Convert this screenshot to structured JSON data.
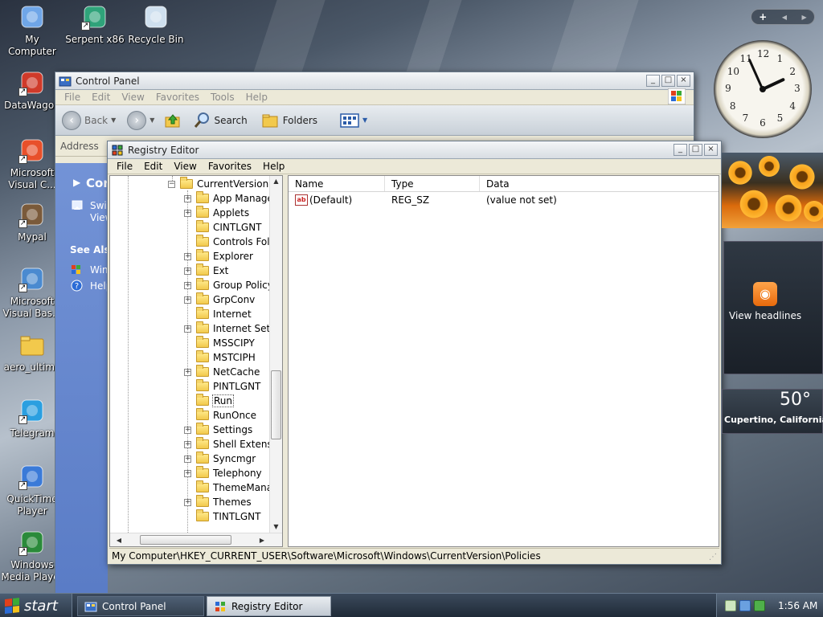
{
  "desktop": {
    "icons": [
      {
        "label": "My Computer",
        "icon": "computer-icon"
      },
      {
        "label": "Serpent x86",
        "icon": "serpent-icon"
      },
      {
        "label": "Recycle Bin",
        "icon": "recycle-bin-icon"
      },
      {
        "label": "DataWagon",
        "icon": "datawagon-icon"
      },
      {
        "label": "Microsoft Visual C...",
        "icon": "visual-c-icon"
      },
      {
        "label": "Mypal",
        "icon": "mypal-icon"
      },
      {
        "label": "Microsoft Visual Bas...",
        "icon": "visual-basic-icon"
      },
      {
        "label": "aero_ultima",
        "icon": "folder-icon"
      },
      {
        "label": "Telegram",
        "icon": "telegram-icon"
      },
      {
        "label": "QuickTime Player",
        "icon": "quicktime-icon"
      },
      {
        "label": "Windows Media Player",
        "icon": "media-player-icon"
      }
    ]
  },
  "control_panel": {
    "title": "Control Panel",
    "menu": [
      "File",
      "Edit",
      "View",
      "Favorites",
      "Tools",
      "Help"
    ],
    "toolbar": {
      "back": "Back",
      "search": "Search",
      "folders": "Folders"
    },
    "address_label": "Address",
    "left_fragments": [
      "Cor",
      "Swit",
      "View",
      "See Also",
      "Win",
      "Help"
    ]
  },
  "registry_editor": {
    "title": "Registry Editor",
    "menu": [
      "File",
      "Edit",
      "View",
      "Favorites",
      "Help"
    ],
    "tree": {
      "root": "CurrentVersion",
      "children": [
        {
          "label": "App Manage",
          "expandable": true
        },
        {
          "label": "Applets",
          "expandable": true
        },
        {
          "label": "CINTLGNT",
          "expandable": false
        },
        {
          "label": "Controls Folc",
          "expandable": false
        },
        {
          "label": "Explorer",
          "expandable": true
        },
        {
          "label": "Ext",
          "expandable": true
        },
        {
          "label": "Group Policy",
          "expandable": true
        },
        {
          "label": "GrpConv",
          "expandable": true
        },
        {
          "label": "Internet",
          "expandable": false
        },
        {
          "label": "Internet Settii",
          "expandable": true
        },
        {
          "label": "MSSCIPY",
          "expandable": false
        },
        {
          "label": "MSTCIPH",
          "expandable": false
        },
        {
          "label": "NetCache",
          "expandable": true
        },
        {
          "label": "PINTLGNT",
          "expandable": false
        },
        {
          "label": "Run",
          "expandable": false,
          "selected": true
        },
        {
          "label": "RunOnce",
          "expandable": false
        },
        {
          "label": "Settings",
          "expandable": true
        },
        {
          "label": "Shell Extensic",
          "expandable": true
        },
        {
          "label": "Syncmgr",
          "expandable": true
        },
        {
          "label": "Telephony",
          "expandable": true
        },
        {
          "label": "ThemeManaç",
          "expandable": false
        },
        {
          "label": "Themes",
          "expandable": true
        },
        {
          "label": "TINTLGNT",
          "expandable": false
        }
      ]
    },
    "columns": [
      "Name",
      "Type",
      "Data"
    ],
    "values": [
      {
        "name": "(Default)",
        "type": "REG_SZ",
        "data": "(value not set)"
      }
    ],
    "status_path": "My Computer\\HKEY_CURRENT_USER\\Software\\Microsoft\\Windows\\CurrentVersion\\Policies"
  },
  "sidebar": {
    "feeds_label": "View headlines",
    "weather": {
      "temperature": "50°",
      "location": "Cupertino, California"
    },
    "clock_numbers": [
      "12",
      "1",
      "2",
      "3",
      "4",
      "5",
      "6",
      "7",
      "8",
      "9",
      "10",
      "11"
    ]
  },
  "taskbar": {
    "start_label": "start",
    "tasks": [
      {
        "label": "Control Panel",
        "active": false
      },
      {
        "label": "Registry Editor",
        "active": true
      }
    ],
    "clock": "1:56 AM"
  },
  "colors": {
    "desktop": "#8d9aaa",
    "cp_panel_blue": "#6b8bd2",
    "rss_orange": "#f08a24",
    "taskbar": "#2c3848"
  }
}
